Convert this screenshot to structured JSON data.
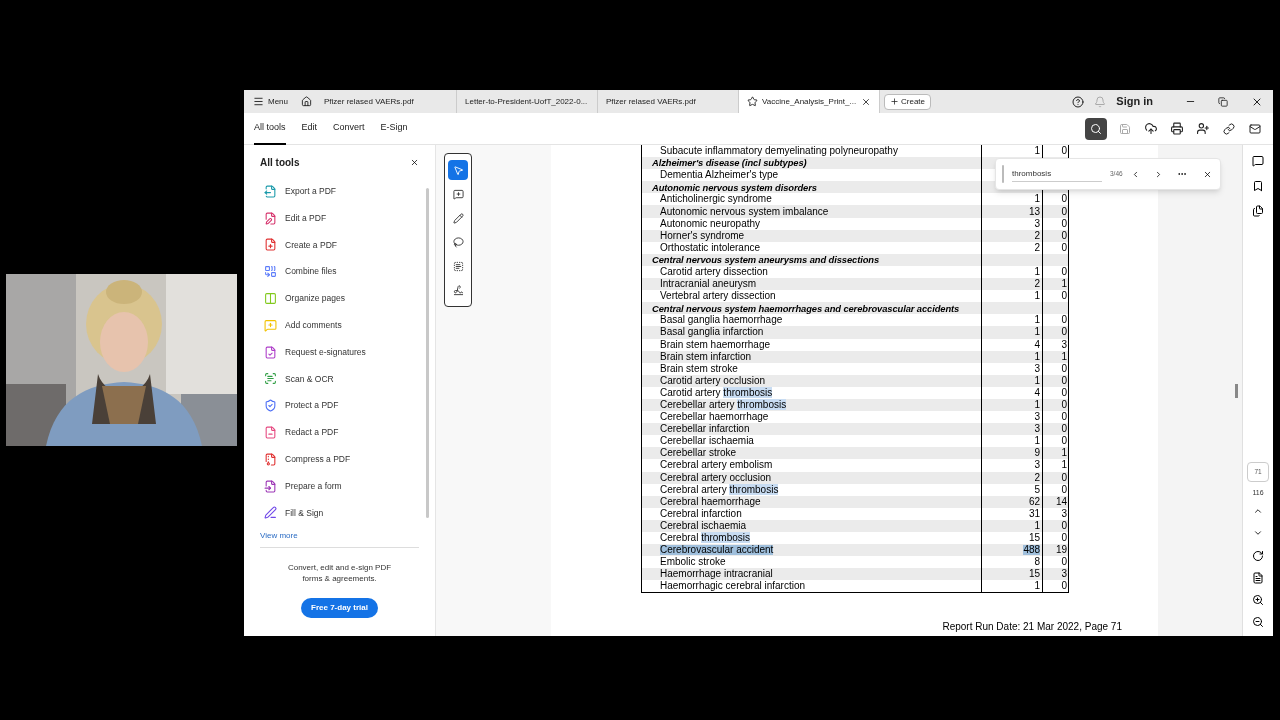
{
  "tab_bar": {
    "menu": "Menu",
    "tabs": [
      {
        "title": "Pfizer relased VAERs.pdf",
        "selected": false
      },
      {
        "title": "Letter-to-President-UofT_2022-0...",
        "selected": false
      },
      {
        "title": "Pfizer relased VAERs.pdf",
        "selected": false
      },
      {
        "title": "Vaccine_Analysis_Print_...",
        "selected": true
      }
    ],
    "create": "Create",
    "sign_in": "Sign in"
  },
  "toolbar": {
    "tabs": [
      {
        "label": "All tools",
        "selected": true
      },
      {
        "label": "Edit",
        "selected": false
      },
      {
        "label": "Convert",
        "selected": false
      },
      {
        "label": "E-Sign",
        "selected": false
      }
    ]
  },
  "tools_panel": {
    "title": "All tools",
    "items": [
      {
        "label": "Export a PDF"
      },
      {
        "label": "Edit a PDF"
      },
      {
        "label": "Create a PDF"
      },
      {
        "label": "Combine files"
      },
      {
        "label": "Organize pages"
      },
      {
        "label": "Add comments"
      },
      {
        "label": "Request e-signatures"
      },
      {
        "label": "Scan & OCR"
      },
      {
        "label": "Protect a PDF"
      },
      {
        "label": "Redact a PDF"
      },
      {
        "label": "Compress a PDF"
      },
      {
        "label": "Prepare a form"
      },
      {
        "label": "Fill & Sign"
      }
    ],
    "view_more": "View more",
    "promo": "Convert, edit and e-sign PDF forms & agreements.",
    "trial_button": "Free 7-day trial"
  },
  "annotation_tools": [
    {
      "selected": true
    },
    {
      "selected": false
    },
    {
      "selected": false
    },
    {
      "selected": false
    },
    {
      "selected": false
    },
    {
      "selected": false
    }
  ],
  "find_bar": {
    "value": "thrombosis",
    "count": "3/46"
  },
  "table": {
    "rows": [
      {
        "kind": "item",
        "name": "Subacute inflammatory demyelinating polyneuropathy",
        "values": [
          "1",
          "0"
        ],
        "selected": false
      },
      {
        "kind": "group",
        "name": "Alzheimer's disease (incl subtypes)"
      },
      {
        "kind": "item",
        "name": "Dementia Alzheimer's type",
        "selected": false
      },
      {
        "kind": "group",
        "name": "Autonomic nervous system disorders"
      },
      {
        "kind": "item",
        "name": "Anticholinergic syndrome",
        "values": [
          "1",
          "0"
        ],
        "selected": false
      },
      {
        "kind": "item",
        "name": "Autonomic nervous system imbalance",
        "values": [
          "13",
          "0"
        ],
        "selected": false
      },
      {
        "kind": "item",
        "name": "Autonomic neuropathy",
        "values": [
          "3",
          "0"
        ],
        "selected": false
      },
      {
        "kind": "item",
        "name": "Horner's syndrome",
        "values": [
          "2",
          "0"
        ],
        "selected": false
      },
      {
        "kind": "item",
        "name": "Orthostatic intolerance",
        "values": [
          "2",
          "0"
        ],
        "selected": false
      },
      {
        "kind": "group",
        "name": "Central nervous system aneurysms and dissections"
      },
      {
        "kind": "item",
        "name": "Carotid artery dissection",
        "values": [
          "1",
          "0"
        ],
        "selected": false
      },
      {
        "kind": "item",
        "name": "Intracranial aneurysm",
        "values": [
          "2",
          "1"
        ],
        "selected": false
      },
      {
        "kind": "item",
        "name": "Vertebral artery dissection",
        "values": [
          "1",
          "0"
        ],
        "selected": false
      },
      {
        "kind": "group",
        "name": "Central nervous system haemorrhages and cerebrovascular accidents"
      },
      {
        "kind": "item",
        "name": "Basal ganglia haemorrhage",
        "values": [
          "1",
          "0"
        ],
        "selected": false
      },
      {
        "kind": "item",
        "name": "Basal ganglia infarction",
        "values": [
          "1",
          "0"
        ],
        "selected": false
      },
      {
        "kind": "item",
        "name": "Brain stem haemorrhage",
        "values": [
          "4",
          "3"
        ],
        "selected": false
      },
      {
        "kind": "item",
        "name": "Brain stem infarction",
        "values": [
          "1",
          "1"
        ],
        "selected": false
      },
      {
        "kind": "item",
        "name": "Brain stem stroke",
        "values": [
          "3",
          "0"
        ],
        "selected": false
      },
      {
        "kind": "item",
        "name": "Carotid artery occlusion",
        "values": [
          "1",
          "0"
        ],
        "selected": false
      },
      {
        "kind": "item",
        "name": "Carotid artery ",
        "match": "thrombosis",
        "values": [
          "4",
          "0"
        ],
        "selected": false
      },
      {
        "kind": "item",
        "name": "Cerebellar artery ",
        "match": "thrombosis",
        "values": [
          "1",
          "0"
        ],
        "selected": false
      },
      {
        "kind": "item",
        "name": "Cerebellar haemorrhage",
        "values": [
          "3",
          "0"
        ],
        "selected": false
      },
      {
        "kind": "item",
        "name": "Cerebellar infarction",
        "values": [
          "3",
          "0"
        ],
        "selected": false
      },
      {
        "kind": "item",
        "name": "Cerebellar ischaemia",
        "values": [
          "1",
          "0"
        ],
        "selected": false
      },
      {
        "kind": "item",
        "name": "Cerebellar stroke",
        "values": [
          "9",
          "1"
        ],
        "selected": false
      },
      {
        "kind": "item",
        "name": "Cerebral artery embolism",
        "values": [
          "3",
          "1"
        ],
        "selected": false
      },
      {
        "kind": "item",
        "name": "Cerebral artery occlusion",
        "values": [
          "2",
          "0"
        ],
        "selected": false
      },
      {
        "kind": "item",
        "name": "Cerebral artery ",
        "match": "thrombosis",
        "values": [
          "5",
          "0"
        ],
        "selected": false
      },
      {
        "kind": "item",
        "name": "Cerebral haemorrhage",
        "values": [
          "62",
          "14"
        ],
        "selected": false
      },
      {
        "kind": "item",
        "name": "Cerebral infarction",
        "values": [
          "31",
          "3"
        ],
        "selected": false
      },
      {
        "kind": "item",
        "name": "Cerebral ischaemia",
        "values": [
          "1",
          "0"
        ],
        "selected": false
      },
      {
        "kind": "item",
        "name": "Cerebral ",
        "match": "thrombosis",
        "values": [
          "15",
          "0"
        ],
        "selected": false
      },
      {
        "kind": "item",
        "name": "Cerebrovascular accident",
        "values": [
          "488",
          "19"
        ],
        "selected": true
      },
      {
        "kind": "item",
        "name": "Embolic stroke",
        "values": [
          "8",
          "0"
        ],
        "selected": false
      },
      {
        "kind": "item",
        "name": "Haemorrhage intracranial",
        "values": [
          "15",
          "3"
        ],
        "selected": false
      },
      {
        "kind": "item",
        "name": "Haemorrhagic cerebral infarction",
        "values": [
          "1",
          "0"
        ],
        "selected": false
      }
    ]
  },
  "footer": "Report Run Date: 21 Mar 2022, Page 71",
  "page_nav": {
    "current": "71",
    "total": "116"
  }
}
